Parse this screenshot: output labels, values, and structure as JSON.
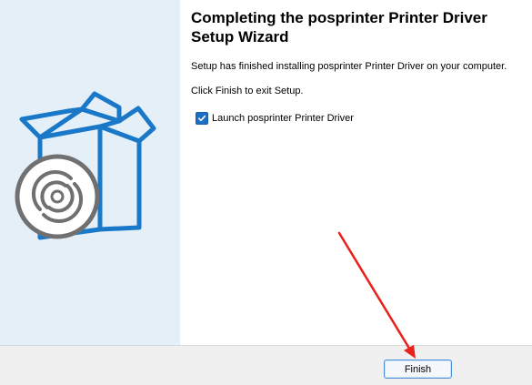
{
  "wizard": {
    "title": "Completing the posprinter Printer Driver Setup Wizard",
    "message_installed": "Setup has finished installing posprinter Printer Driver on your computer.",
    "message_exit": "Click Finish to exit Setup.",
    "launch_checkbox": {
      "label": "Launch  posprinter Printer Driver",
      "checked": true
    }
  },
  "buttons": {
    "finish_label": "Finish"
  },
  "sidebar": {
    "graphic": "software-box-with-disc-icon"
  },
  "colors": {
    "sidebar_bg": "#e5eff8",
    "box_blue": "#1a78c8",
    "disc_gray": "#707070",
    "arrow_red": "#e8211a",
    "accent": "#1d6fc4"
  }
}
